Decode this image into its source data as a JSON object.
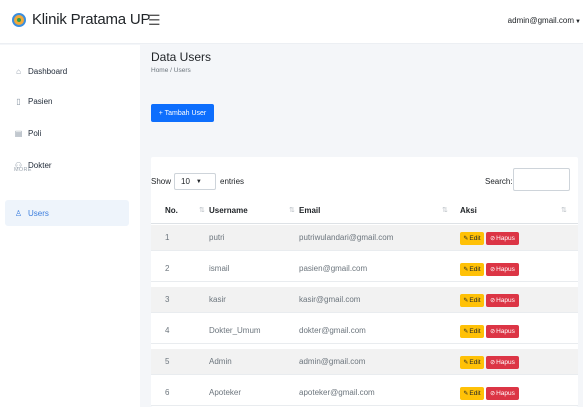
{
  "app": {
    "name": "Klinik Pratama UP"
  },
  "header": {
    "user_email": "admin@gmail.com"
  },
  "sidebar": {
    "items": [
      {
        "label": "Dashboard"
      },
      {
        "label": "Pasien"
      },
      {
        "label": "Poli"
      },
      {
        "label": "Dokter"
      },
      {
        "label": "Users"
      }
    ],
    "section_label": "MORE"
  },
  "page": {
    "title": "Data Users",
    "breadcrumb": "Home  /  Users",
    "add_button": "+ Tambah User"
  },
  "table": {
    "show_label": "Show",
    "page_length": "10",
    "entries_label": "entries",
    "search_label": "Search:",
    "columns": [
      "No.",
      "Username",
      "Email",
      "Aksi"
    ],
    "rows": [
      {
        "no": "1",
        "username": "putri",
        "email": "putriwulandari@gmail.com"
      },
      {
        "no": "2",
        "username": "ismail",
        "email": "pasien@gmail.com"
      },
      {
        "no": "3",
        "username": "kasir",
        "email": "kasir@gmail.com"
      },
      {
        "no": "4",
        "username": "Dokter_Umum",
        "email": "dokter@gmail.com"
      },
      {
        "no": "5",
        "username": "Admin",
        "email": "admin@gmail.com"
      },
      {
        "no": "6",
        "username": "Apoteker",
        "email": "apoteker@gmail.com"
      }
    ],
    "edit_label": "Edit",
    "delete_label": "Hapus"
  },
  "colors": {
    "primary": "#0d6efd",
    "warning": "#ffc107",
    "danger": "#dc3545",
    "active_nav": "#3b7ddd"
  }
}
